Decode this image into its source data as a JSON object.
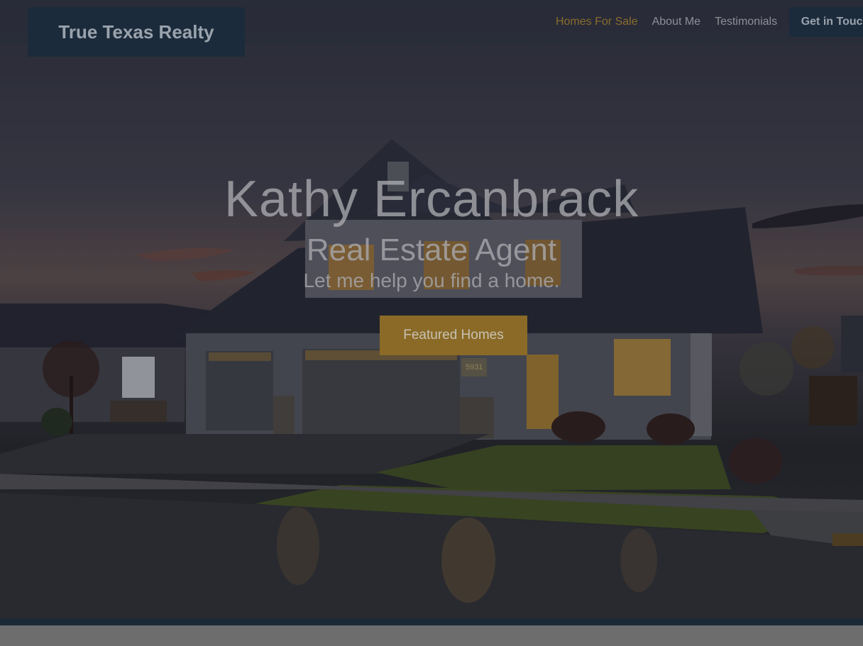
{
  "brand": {
    "name": "True Texas Realty"
  },
  "nav": {
    "items": [
      {
        "label": "Homes For Sale",
        "active": true
      },
      {
        "label": "About Me",
        "active": false
      },
      {
        "label": "Testimonials",
        "active": false
      }
    ],
    "cta_label": "Get in Touch"
  },
  "hero": {
    "name": "Kathy Ercanbrack",
    "role": "Real Estate Agent",
    "tagline": "Let me help you find a home.",
    "button_label": "Featured Homes",
    "house_number": "5931"
  },
  "colors": {
    "accent": "#8a6a26",
    "nav_active": "#8a6d2c",
    "brand_bg": "#1c2b3b"
  }
}
